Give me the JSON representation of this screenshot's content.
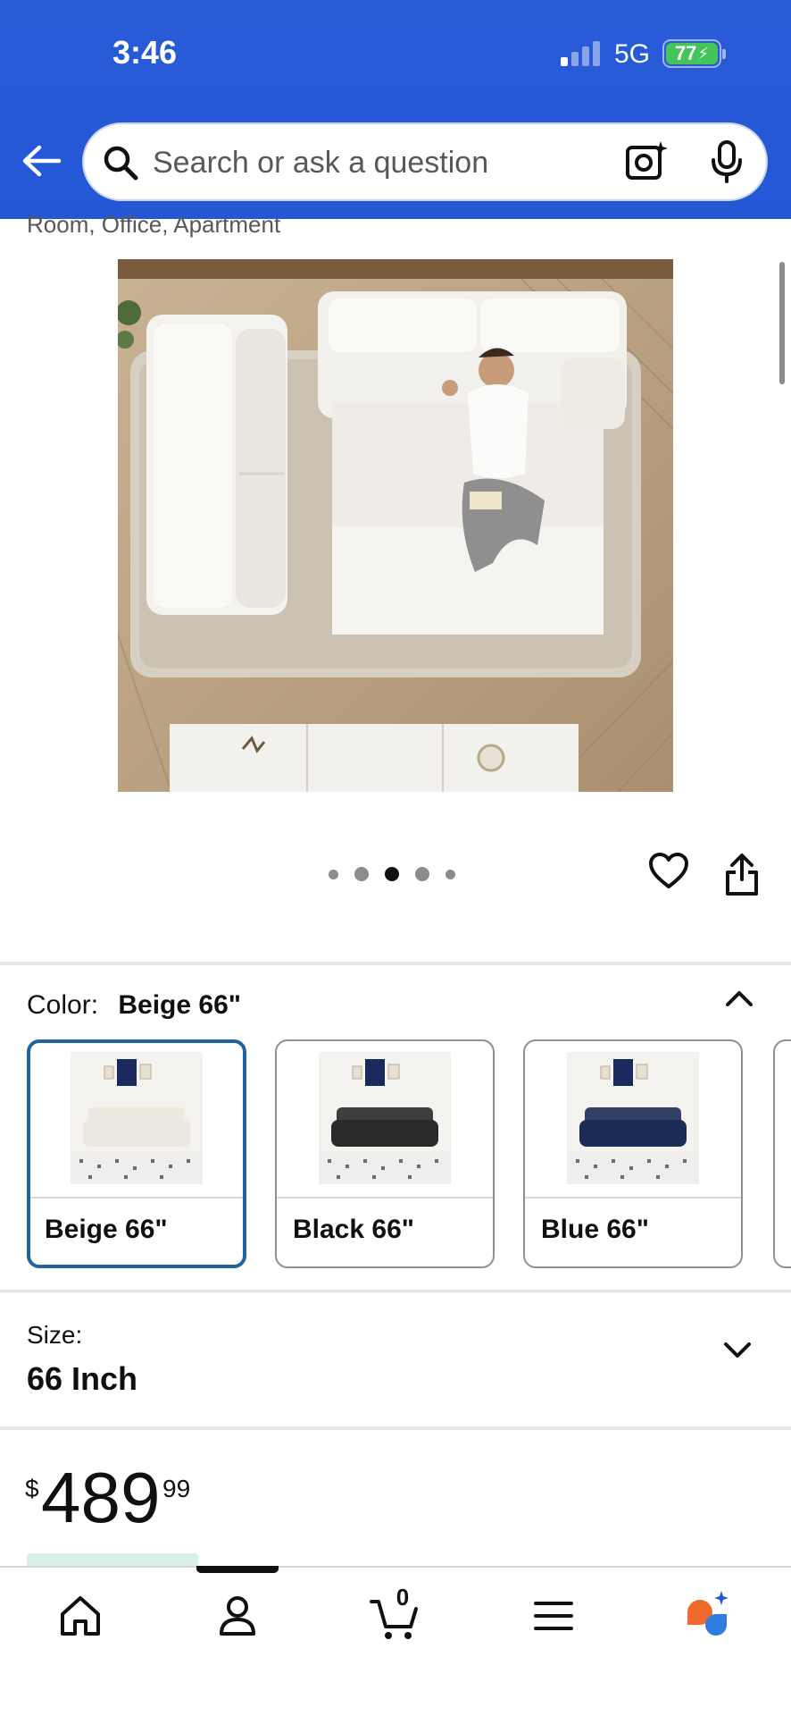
{
  "status_bar": {
    "time": "3:46",
    "network": "5G",
    "battery": "77"
  },
  "header": {
    "search_placeholder": "Search or ask a question"
  },
  "product": {
    "subtitle_fragment": "Room, Office, Apartment",
    "image_alt": "Top view of white sofa set with man reading",
    "carousel": {
      "count": 5,
      "active_index": 2
    }
  },
  "color": {
    "label": "Color:",
    "selected": "Beige 66\"",
    "options": [
      {
        "name": "Beige 66\"",
        "sofa_color": "#ece8df",
        "selected": true
      },
      {
        "name": "Black 66\"",
        "sofa_color": "#2a2a2a",
        "selected": false
      },
      {
        "name": "Blue 66\"",
        "sofa_color": "#1d2c57",
        "selected": false
      }
    ]
  },
  "size": {
    "label": "Size:",
    "value": "66 Inch"
  },
  "price": {
    "currency": "$",
    "whole": "489",
    "fraction": "99"
  },
  "tabbar": {
    "items": [
      {
        "name": "home",
        "icon": "home-icon"
      },
      {
        "name": "account",
        "icon": "person-icon"
      },
      {
        "name": "cart",
        "icon": "cart-icon",
        "count": "0"
      },
      {
        "name": "menu",
        "icon": "menu-icon"
      },
      {
        "name": "rufus",
        "icon": "assistant-icon"
      }
    ],
    "active_index": 1
  },
  "colors": {
    "header_blue": "#2357d6",
    "selected_border": "#2162a1",
    "battery_green": "#43c55a"
  }
}
